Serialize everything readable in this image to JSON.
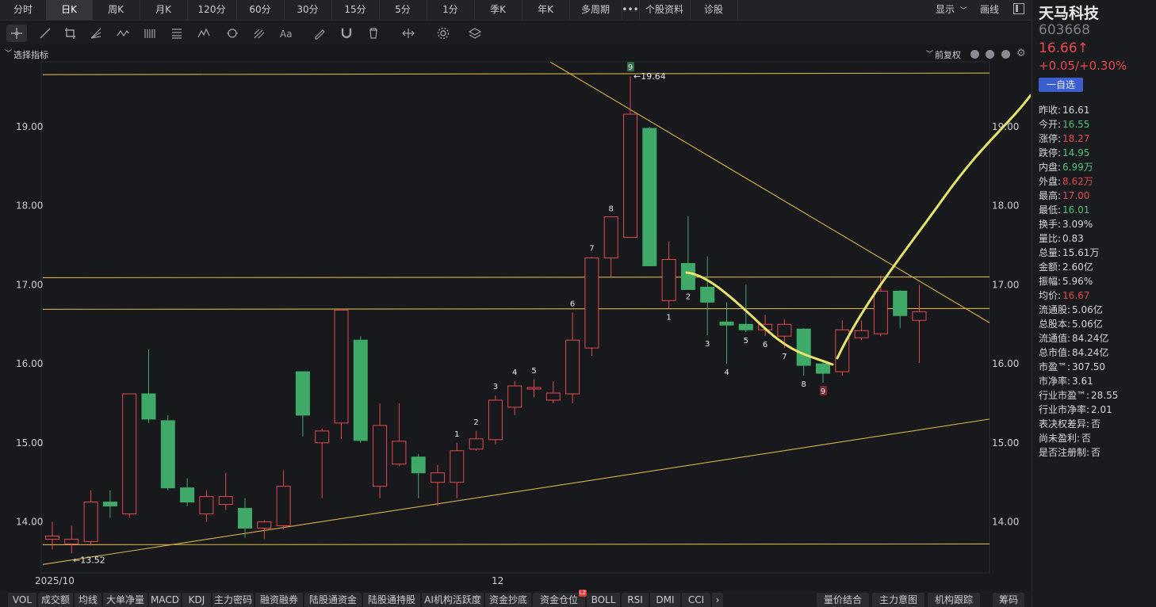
{
  "period_tabs": [
    "分时",
    "日K",
    "周K",
    "月K",
    "120分",
    "60分",
    "30分",
    "15分",
    "5分",
    "1分",
    "季K",
    "年K",
    "多周期",
    "•••",
    "个股资料",
    "诊股"
  ],
  "active_period": "日K",
  "top_right": {
    "display_label": "显示",
    "draw_label": "画线"
  },
  "toolbar_icons": [
    "crosshair-icon",
    "line-icon",
    "crop-icon",
    "fan-icon",
    "wave-icon",
    "bars-icon",
    "list-icon",
    "zigzag-icon",
    "cycle-icon",
    "pitchfork-icon",
    "text-icon",
    "pen-icon",
    "magnet-icon",
    "trash-icon",
    "arrows-icon",
    "settings-icon",
    "layers-icon"
  ],
  "indicator_header": {
    "select_label": "选择指标",
    "adjust_label": "前复权"
  },
  "chart_data": {
    "type": "candlestick",
    "y_ticks": [
      "19.00",
      "18.00",
      "17.00",
      "16.00",
      "15.00",
      "14.00"
    ],
    "x_labels": [
      "2025/10",
      "12"
    ],
    "high_label": "19.64",
    "low_label": "13.52",
    "candles": [
      {
        "o": 13.78,
        "h": 14.0,
        "l": 13.65,
        "c": 13.82
      },
      {
        "o": 13.72,
        "h": 13.95,
        "l": 13.6,
        "c": 13.78
      },
      {
        "o": 13.75,
        "h": 14.4,
        "l": 13.7,
        "c": 14.25
      },
      {
        "o": 14.25,
        "h": 14.4,
        "l": 14.05,
        "c": 14.2
      },
      {
        "o": 14.1,
        "h": 15.6,
        "l": 14.05,
        "c": 15.62
      },
      {
        "o": 15.62,
        "h": 16.18,
        "l": 15.25,
        "c": 15.3
      },
      {
        "o": 15.28,
        "h": 15.35,
        "l": 14.4,
        "c": 14.43
      },
      {
        "o": 14.43,
        "h": 14.55,
        "l": 14.2,
        "c": 14.25
      },
      {
        "o": 14.1,
        "h": 14.4,
        "l": 14.0,
        "c": 14.32
      },
      {
        "o": 14.22,
        "h": 14.62,
        "l": 14.15,
        "c": 14.32
      },
      {
        "o": 14.17,
        "h": 14.3,
        "l": 13.8,
        "c": 13.92
      },
      {
        "o": 13.92,
        "h": 14.02,
        "l": 13.78,
        "c": 14.0
      },
      {
        "o": 13.95,
        "h": 14.65,
        "l": 13.9,
        "c": 14.45
      },
      {
        "o": 15.9,
        "h": 15.9,
        "l": 15.08,
        "c": 15.35
      },
      {
        "o": 15.0,
        "h": 15.18,
        "l": 14.3,
        "c": 15.15
      },
      {
        "o": 15.25,
        "h": 16.7,
        "l": 15.05,
        "c": 16.68
      },
      {
        "o": 16.3,
        "h": 16.35,
        "l": 15.0,
        "c": 15.03
      },
      {
        "o": 14.45,
        "h": 15.5,
        "l": 14.3,
        "c": 15.22
      },
      {
        "o": 14.73,
        "h": 15.5,
        "l": 14.7,
        "c": 15.02
      },
      {
        "o": 14.82,
        "h": 14.86,
        "l": 14.3,
        "c": 14.62
      },
      {
        "o": 14.5,
        "h": 14.72,
        "l": 14.2,
        "c": 14.62
      },
      {
        "o": 14.5,
        "h": 15.0,
        "l": 14.3,
        "c": 14.9
      },
      {
        "o": 14.92,
        "h": 15.15,
        "l": 14.9,
        "c": 15.05
      },
      {
        "o": 15.04,
        "h": 15.6,
        "l": 14.98,
        "c": 15.54
      },
      {
        "o": 15.45,
        "h": 15.78,
        "l": 15.35,
        "c": 15.72
      },
      {
        "o": 15.68,
        "h": 15.8,
        "l": 15.58,
        "c": 15.7
      },
      {
        "o": 15.54,
        "h": 15.78,
        "l": 15.5,
        "c": 15.63
      },
      {
        "o": 15.62,
        "h": 16.65,
        "l": 15.5,
        "c": 16.3
      },
      {
        "o": 16.2,
        "h": 17.35,
        "l": 16.1,
        "c": 17.34
      },
      {
        "o": 17.34,
        "h": 17.85,
        "l": 17.1,
        "c": 17.86
      },
      {
        "o": 17.6,
        "h": 19.64,
        "l": 17.6,
        "c": 19.16
      },
      {
        "o": 18.98,
        "h": 19.0,
        "l": 17.24,
        "c": 17.24
      },
      {
        "o": 16.8,
        "h": 17.55,
        "l": 16.7,
        "c": 17.32
      },
      {
        "o": 17.27,
        "h": 17.87,
        "l": 16.96,
        "c": 16.94
      },
      {
        "o": 16.97,
        "h": 17.36,
        "l": 16.36,
        "c": 16.78
      },
      {
        "o": 16.53,
        "h": 16.78,
        "l": 16.0,
        "c": 16.49
      },
      {
        "o": 16.5,
        "h": 17.0,
        "l": 16.4,
        "c": 16.43
      },
      {
        "o": 16.43,
        "h": 16.62,
        "l": 16.35,
        "c": 16.5
      },
      {
        "o": 16.35,
        "h": 16.56,
        "l": 16.2,
        "c": 16.5
      },
      {
        "o": 16.44,
        "h": 16.45,
        "l": 15.85,
        "c": 15.98
      },
      {
        "o": 16.0,
        "h": 16.05,
        "l": 15.76,
        "c": 15.88
      },
      {
        "o": 15.9,
        "h": 16.55,
        "l": 15.85,
        "c": 16.43
      },
      {
        "o": 16.33,
        "h": 16.55,
        "l": 16.3,
        "c": 16.42
      },
      {
        "o": 16.38,
        "h": 17.12,
        "l": 16.35,
        "c": 16.92
      },
      {
        "o": 16.92,
        "h": 16.93,
        "l": 16.45,
        "c": 16.61
      },
      {
        "o": 16.55,
        "h": 17.0,
        "l": 16.01,
        "c": 16.66
      }
    ],
    "count_marks": [
      {
        "i": 21,
        "t": "1"
      },
      {
        "i": 22,
        "t": "2"
      },
      {
        "i": 23,
        "t": "3"
      },
      {
        "i": 24,
        "t": "4"
      },
      {
        "i": 25,
        "t": "5"
      },
      {
        "i": 27,
        "t": "6"
      },
      {
        "i": 28,
        "t": "7"
      },
      {
        "i": 29,
        "t": "8"
      },
      {
        "i": 30,
        "t": "9"
      },
      {
        "i": 32,
        "t": "1"
      },
      {
        "i": 33,
        "t": "2"
      },
      {
        "i": 34,
        "t": "3"
      },
      {
        "i": 35,
        "t": "4"
      },
      {
        "i": 36,
        "t": "5"
      },
      {
        "i": 37,
        "t": "6"
      },
      {
        "i": 38,
        "t": "7"
      },
      {
        "i": 39,
        "t": "8"
      },
      {
        "i": 40,
        "t": "9"
      }
    ],
    "colors": {
      "up": "#e5484d",
      "down": "#3fa968",
      "trendline": "#d7b24a",
      "hand": "#e8e66a"
    }
  },
  "bottom_tabs": [
    "VOL",
    "成交额",
    "均线",
    "大单净量",
    "MACD",
    "KDJ",
    "主力密码",
    "融资融券",
    "陆股通资金",
    "陆股通持股",
    "AI机构活跃度",
    "资金抄底",
    "资金仓位",
    "BOLL",
    "RSI",
    "DMI",
    "CCI",
    "›"
  ],
  "bottom_badge": "L2",
  "bottom_right_tabs": [
    "量价结合",
    "主力意图",
    "机构跟踪"
  ],
  "chip_tab": "筹码",
  "stock": {
    "name": "天马科技",
    "code": "603668",
    "price": "16.66↑",
    "change": "+0.05/+0.30%",
    "watch_label": "一自选",
    "stats": [
      {
        "label": "昨收:",
        "value": "16.61",
        "color": "white"
      },
      {
        "label": "今开:",
        "value": "16.55",
        "color": "green"
      },
      {
        "label": "涨停:",
        "value": "18.27",
        "color": "red"
      },
      {
        "label": "跌停:",
        "value": "14.95",
        "color": "green"
      },
      {
        "label": "内盘:",
        "value": "6.99万",
        "color": "green"
      },
      {
        "label": "外盘:",
        "value": "8.62万",
        "color": "red"
      },
      {
        "label": "最高:",
        "value": "17.00",
        "color": "red"
      },
      {
        "label": "最低:",
        "value": "16.01",
        "color": "green"
      },
      {
        "label": "换手:",
        "value": "3.09%",
        "color": "white"
      },
      {
        "label": "量比:",
        "value": "0.83",
        "color": "white"
      },
      {
        "label": "总量:",
        "value": "15.61万",
        "color": "white"
      },
      {
        "label": "金额:",
        "value": "2.60亿",
        "color": "white"
      },
      {
        "label": "振幅:",
        "value": "5.96%",
        "color": "white"
      },
      {
        "label": "均价:",
        "value": "16.67",
        "color": "red"
      },
      {
        "label": "流通股:",
        "value": "5.06亿",
        "color": "white"
      },
      {
        "label": "总股本:",
        "value": "5.06亿",
        "color": "white"
      },
      {
        "label": "流通值:",
        "value": "84.24亿",
        "color": "white"
      },
      {
        "label": "总市值:",
        "value": "84.24亿",
        "color": "white"
      },
      {
        "label": "市盈™:",
        "value": "307.50",
        "color": "white"
      },
      {
        "label": "市净率:",
        "value": "3.61",
        "color": "white"
      },
      {
        "label": "行业市盈™:",
        "value": "28.55",
        "color": "white"
      },
      {
        "label": "行业市净率:",
        "value": "2.01",
        "color": "white"
      },
      {
        "label": "表决权差异:",
        "value": "否",
        "color": "white"
      },
      {
        "label": "尚未盈利:",
        "value": "否",
        "color": "white"
      },
      {
        "label": "是否注册制:",
        "value": "否",
        "color": "white"
      }
    ]
  }
}
